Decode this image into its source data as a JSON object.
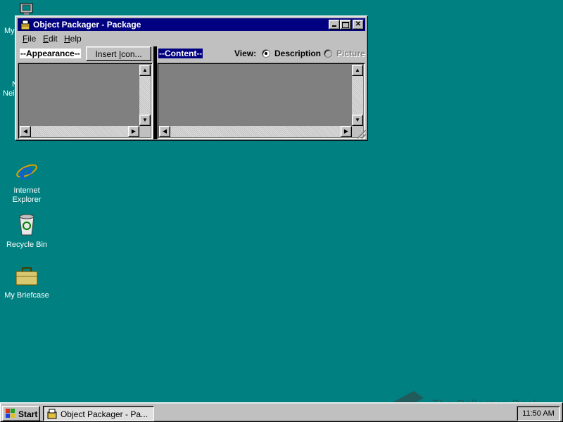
{
  "desktop": {
    "partial_icon_label_1": "My",
    "partial_icon_label_2": "N",
    "partial_icon_label_3": "Nei",
    "icons": [
      {
        "line1": "Internet",
        "line2": "Explorer",
        "icon": "internet-explorer-icon"
      },
      {
        "line1": "Recycle Bin",
        "line2": "",
        "icon": "recycle-bin-icon"
      },
      {
        "line1": "My Briefcase",
        "line2": "",
        "icon": "briefcase-icon"
      }
    ]
  },
  "window": {
    "title": "Object Packager - Package",
    "menu": [
      {
        "accel": "F",
        "rest": "ile"
      },
      {
        "accel": "E",
        "rest": "dit"
      },
      {
        "accel": "H",
        "rest": "elp"
      }
    ],
    "appearance_label": "--Appearance--",
    "insert_icon_button": {
      "before": "Insert ",
      "accel": "I",
      "after": "con..."
    },
    "content_label": "--Content--",
    "view_label": "View:",
    "view_options": [
      {
        "label": "Description",
        "selected": true,
        "enabled": true
      },
      {
        "label": "Picture",
        "selected": false,
        "enabled": false
      }
    ],
    "caption_buttons": [
      "minimize",
      "maximize",
      "close"
    ]
  },
  "taskbar": {
    "start_label": "Start",
    "task_label": "Object Packager - Pa...",
    "clock": "11:50 AM"
  },
  "watermark": {
    "text": "The Collection Book"
  },
  "colors": {
    "desktop": "#008080",
    "titlebar": "#000080",
    "face": "#c0c0c0"
  }
}
